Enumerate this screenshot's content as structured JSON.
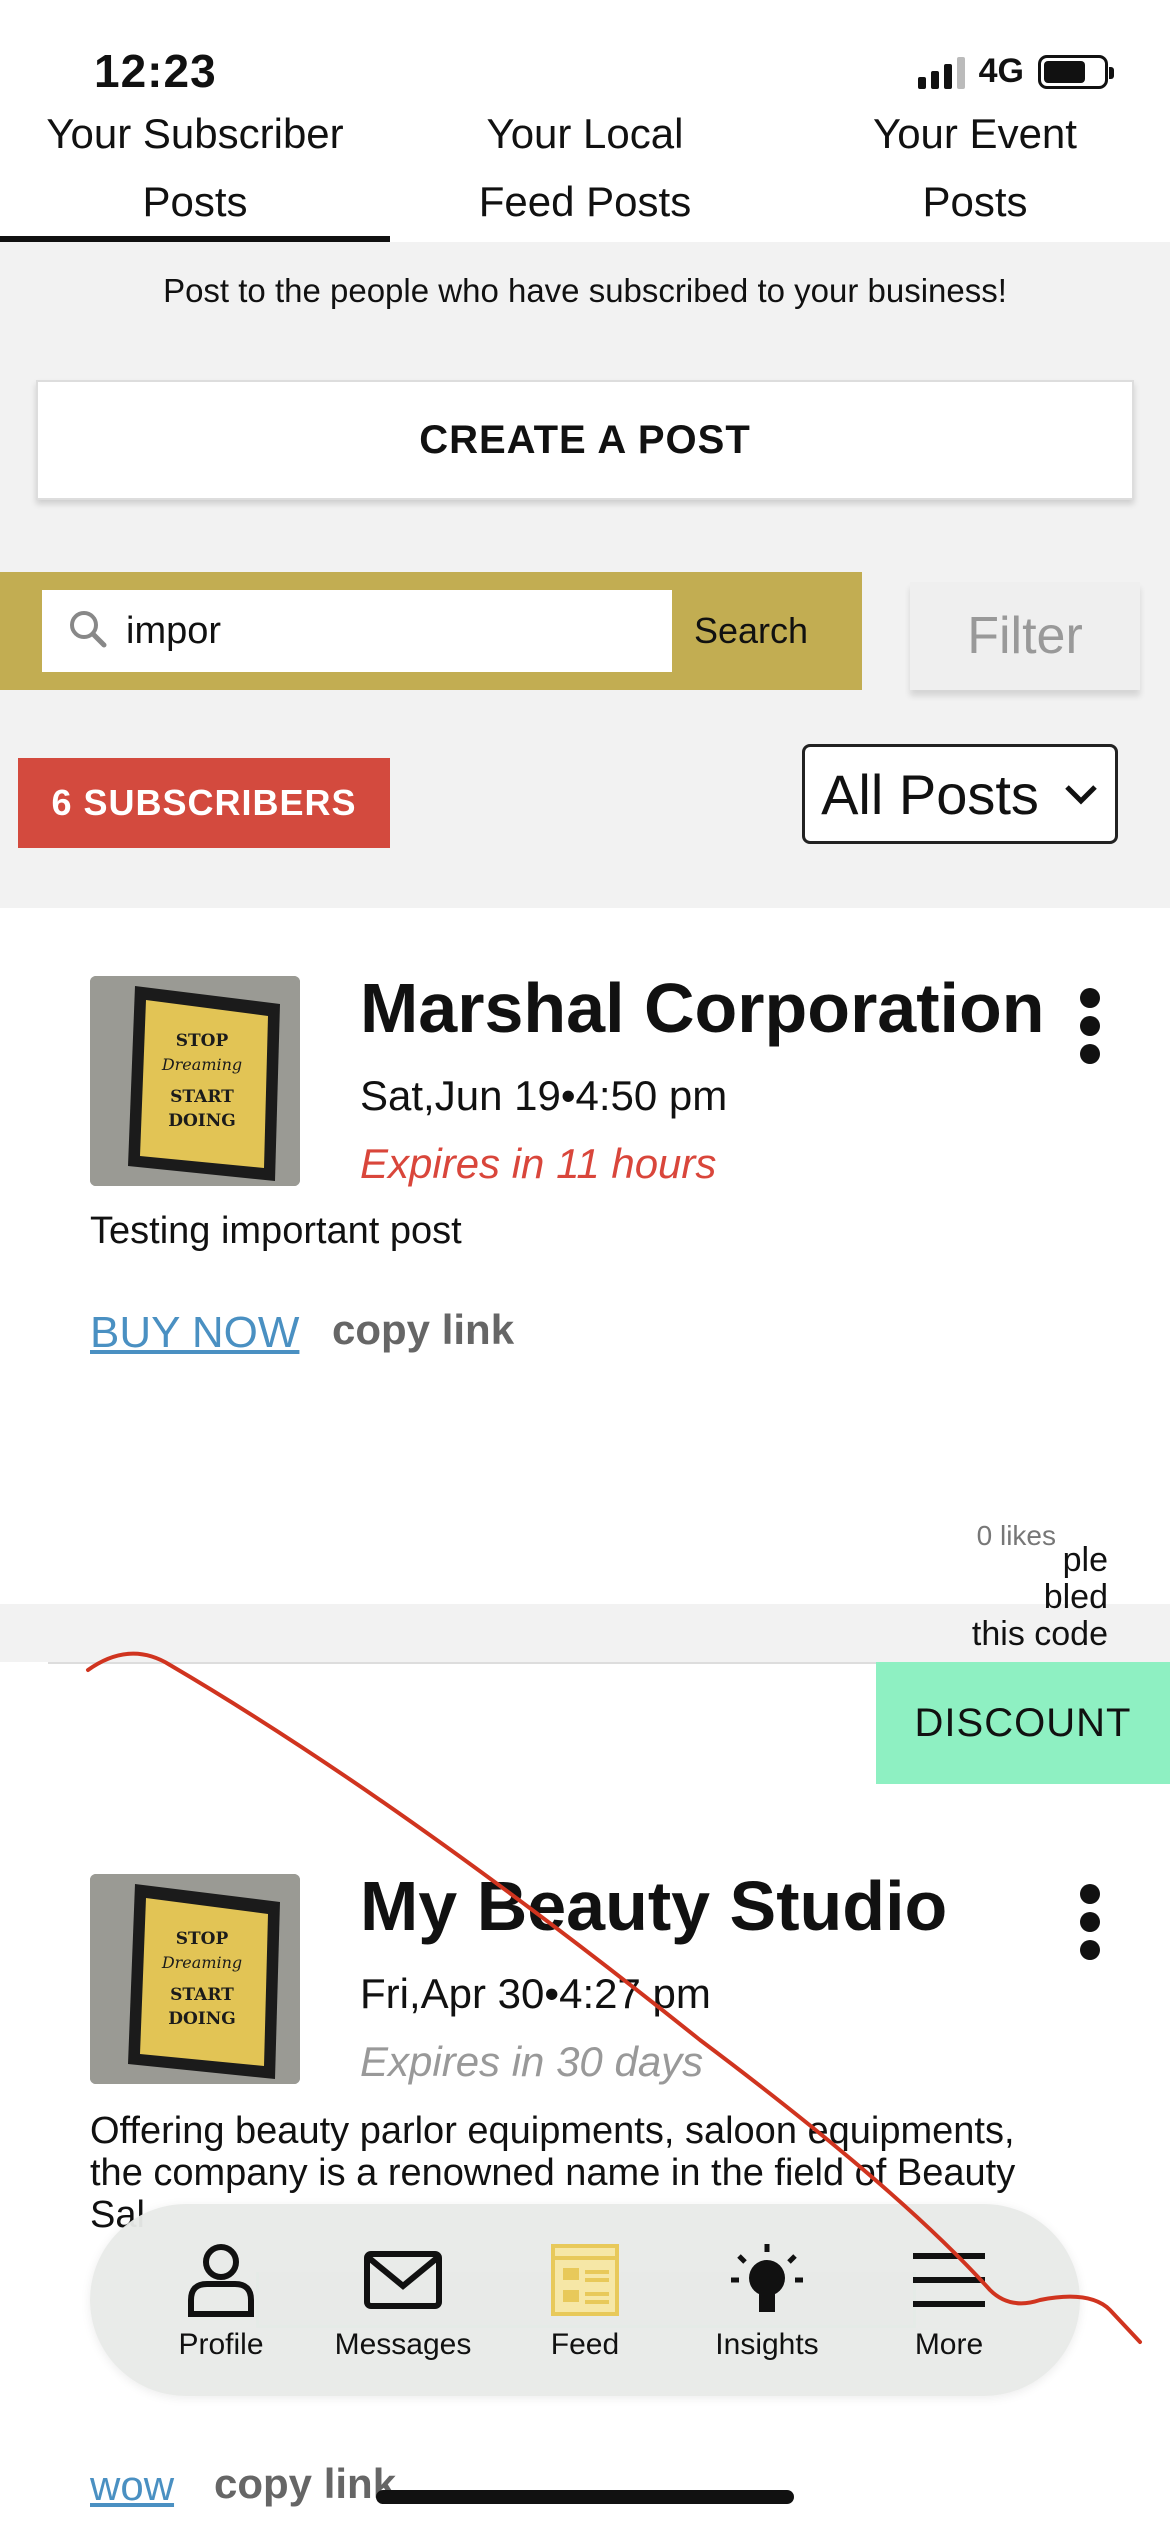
{
  "status": {
    "time": "12:23",
    "network": "4G"
  },
  "tabs": [
    {
      "label1": "Your Subscriber",
      "label2": "Posts"
    },
    {
      "label1": "Your Local",
      "label2": "Feed Posts"
    },
    {
      "label1": "Your Event",
      "label2": "Posts"
    }
  ],
  "intro_text": "Post to the people who have subscribed to your business!",
  "create_post_label": "CREATE A POST",
  "search": {
    "value": "impor",
    "button_label": "Search"
  },
  "filter_label": "Filter",
  "subscribers_badge": "6 SUBSCRIBERS",
  "posts_dropdown": {
    "selected": "All Posts"
  },
  "posts": [
    {
      "company": "Marshal Corporation",
      "date": "Sat,Jun 19•4:50 pm",
      "expires": "Expires in 11 hours",
      "expires_color": "#d9463b",
      "description": "Testing important post",
      "link_label": "BUY NOW",
      "copy_label": "copy link",
      "likes": "0 likes"
    },
    {
      "tag": "DISCOUNT",
      "company": "My Beauty Studio",
      "date": "Fri,Apr 30•4:27 pm",
      "expires": "Expires in 30 days",
      "expires_color": "#999999",
      "description_line1": "Offering beauty parlor equipments, saloon equipments,",
      "description_line2": "the company is a renowned name in the field of Beauty",
      "description_line3": "Sal",
      "side_note_line1": "ple",
      "side_note_line2": "bled",
      "side_note_line3": "this code",
      "link_label": "wow",
      "copy_label": "copy link"
    }
  ],
  "thumbnail_text": {
    "l1": "STOP",
    "l2": "Dreaming",
    "l3": "START",
    "l4": "DOING"
  },
  "bottom_nav": [
    {
      "label": "Profile",
      "icon": "person-icon"
    },
    {
      "label": "Messages",
      "icon": "envelope-icon"
    },
    {
      "label": "Feed",
      "icon": "feed-icon",
      "active_color": "#e8c95a"
    },
    {
      "label": "Insights",
      "icon": "lightbulb-icon"
    },
    {
      "label": "More",
      "icon": "menu-icon"
    }
  ],
  "colors": {
    "search_bar": "#c2ad52",
    "badge": "#d34a3e",
    "discount": "#8ef0c2",
    "link": "#4a90c2",
    "annotation": "#d0341f"
  }
}
